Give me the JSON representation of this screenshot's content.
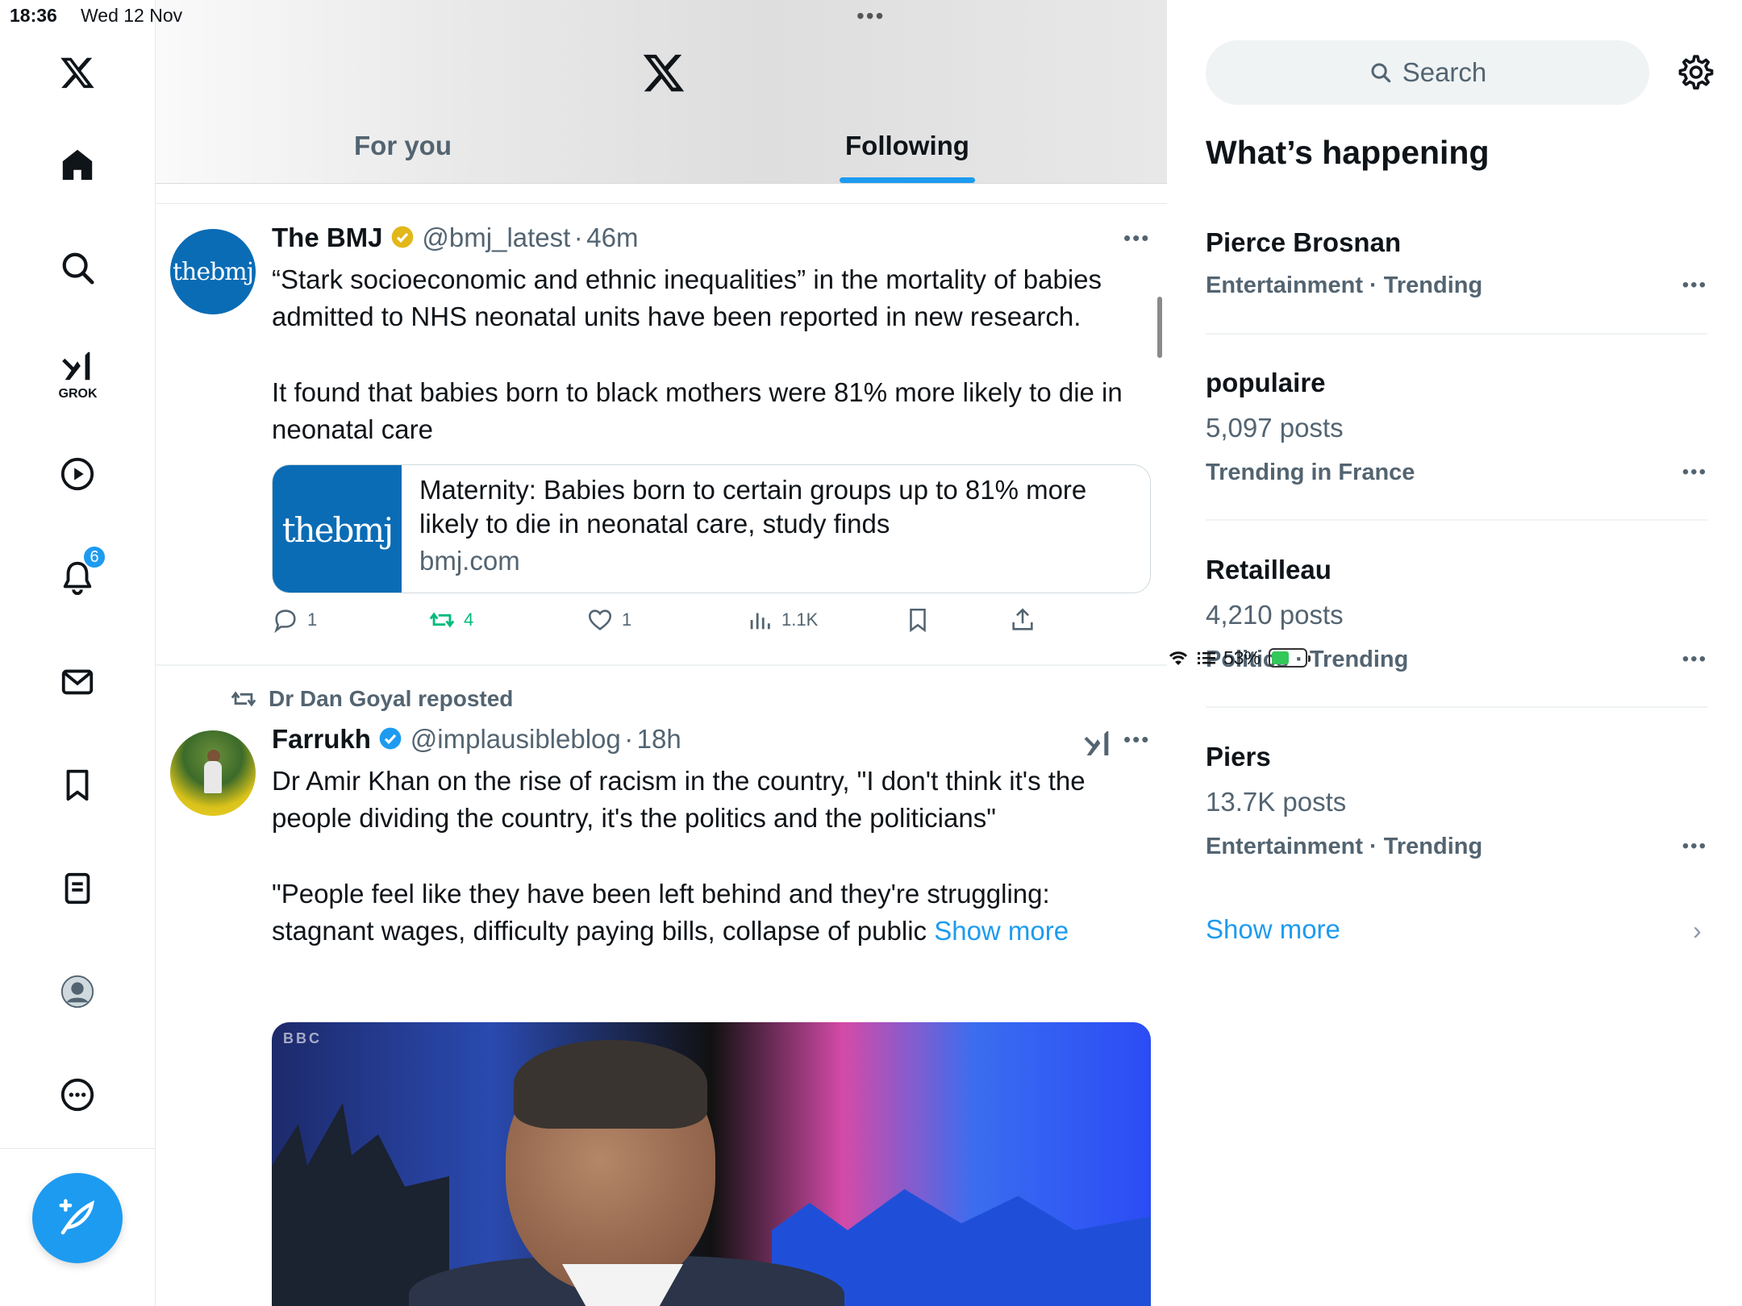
{
  "status_bar": {
    "time": "18:36",
    "date": "Wed 12 Nov",
    "battery_percent": "53%",
    "battery_level": 0.53
  },
  "nav": {
    "items": [
      {
        "name": "x-logo-icon"
      },
      {
        "name": "home-icon"
      },
      {
        "name": "search-icon"
      },
      {
        "name": "grok-icon",
        "label": "GROK"
      },
      {
        "name": "video-icon"
      },
      {
        "name": "notifications-icon",
        "badge": "6"
      },
      {
        "name": "messages-icon"
      },
      {
        "name": "bookmarks-icon"
      },
      {
        "name": "lists-icon"
      },
      {
        "name": "profile-icon"
      },
      {
        "name": "more-icon"
      }
    ],
    "compose_icon": "compose-feather-icon"
  },
  "header": {
    "tabs": [
      {
        "label": "For you",
        "active": false
      },
      {
        "label": "Following",
        "active": true
      }
    ]
  },
  "feed": {
    "tweets": [
      {
        "avatar_text": "thebmj",
        "name": "The BMJ",
        "verified": "gold",
        "handle": "@bmj_latest",
        "sep": "·",
        "time": "46m",
        "text_p1": "“Stark socioeconomic and ethnic inequalities” in the mortality of babies admitted to NHS neonatal units have been reported in new research.",
        "text_p2": "It found that babies born to black mothers were 81% more likely to die in neonatal care",
        "card": {
          "thumb_text": "thebmj",
          "title": "Maternity: Babies born to certain groups up to 81% more likely to die in neonatal care, study finds",
          "domain": "bmj.com"
        },
        "actions": {
          "replies": "1",
          "reposts": "4",
          "likes": "1",
          "views": "1.1K"
        }
      },
      {
        "repost_by": "Dr Dan Goyal reposted",
        "name": "Farrukh",
        "verified": "blue",
        "handle": "@implausibleblog",
        "sep": "·",
        "time": "18h",
        "text_p1": "Dr Amir Khan on the rise of racism in the country, \"I don't think it's the people dividing the country, it's the politics and the politicians\"",
        "text_p2": "\"People feel like they have been left behind and they're struggling: stagnant wages, difficulty paying bills, collapse of public ",
        "show_more": "Show more",
        "media_watermark": "BBC"
      }
    ]
  },
  "sidebar": {
    "search_placeholder": "Search",
    "title": "What’s happening",
    "trends": [
      {
        "name": "Pierce Brosnan",
        "posts": "",
        "category": "Entertainment · Trending"
      },
      {
        "name": "populaire",
        "posts": "5,097 posts",
        "category": "Trending in France"
      },
      {
        "name": "Retailleau",
        "posts": "4,210 posts",
        "category": "Politics · Trending"
      },
      {
        "name": "Piers",
        "posts": "13.7K posts",
        "category": "Entertainment · Trending"
      }
    ],
    "show_more": "Show more"
  },
  "colors": {
    "accent": "#1d9bf0",
    "repost_green": "#00ba7c",
    "bmj_blue": "#0a6cb5",
    "secondary_text": "#536471"
  }
}
